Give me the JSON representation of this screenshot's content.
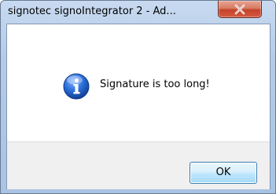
{
  "window": {
    "title": "signotec signoIntegrator 2 - Ad..."
  },
  "titlebar": {
    "close_label": "X"
  },
  "dialog": {
    "icon": "info-icon",
    "message": "Signature is too long!"
  },
  "buttons": {
    "ok_label": "OK"
  },
  "colors": {
    "titlebar": "#b4cbe8",
    "close_button": "#c4432a",
    "footer": "#f0f0f0",
    "ok_border": "#3c7fb1",
    "info_icon": "#1c5fc6"
  }
}
